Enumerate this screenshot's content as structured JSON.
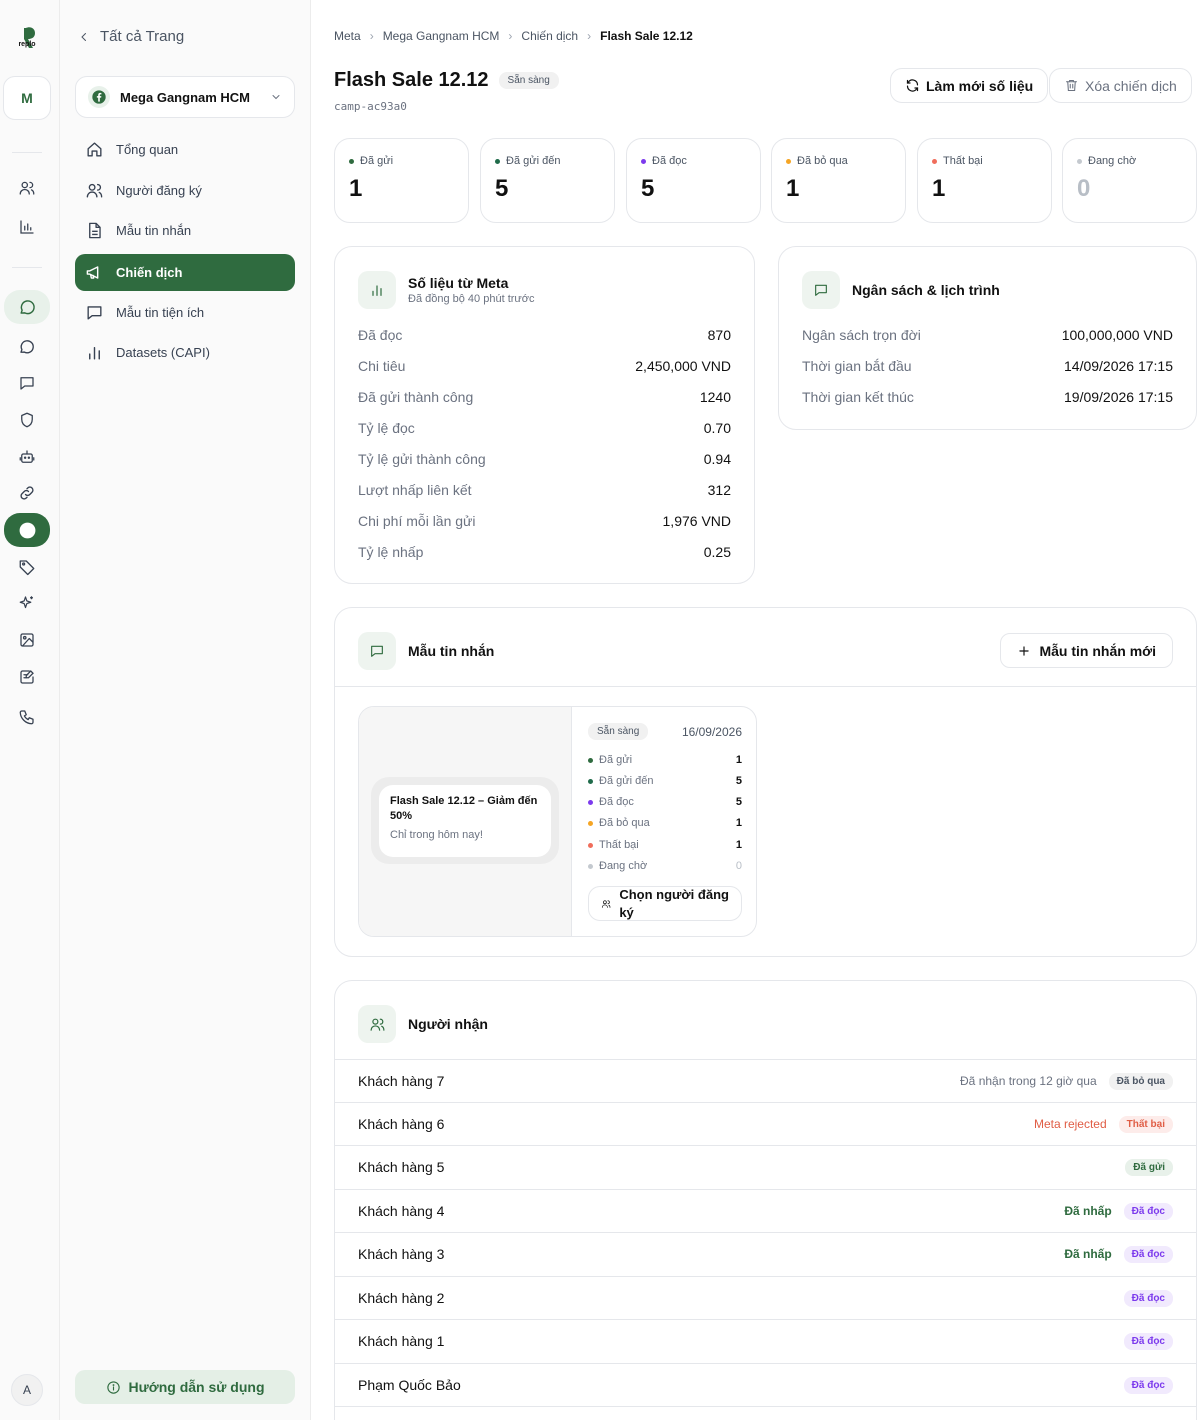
{
  "brand": {
    "logo_text": "replo",
    "workspace_initial": "M",
    "user_initial": "A"
  },
  "rail_icons": [
    "users-icon",
    "chart-icon",
    "chat-icon",
    "chat-outline-icon",
    "message-square-icon",
    "shield-icon",
    "bot-icon",
    "link-icon",
    "facebook-icon",
    "tag-icon",
    "sparkles-icon",
    "image-icon",
    "form-icon",
    "phone-icon"
  ],
  "sidebar": {
    "back_label": "Tất cả Trang",
    "page_name": "Mega Gangnam HCM",
    "items": [
      {
        "label": "Tổng quan",
        "icon": "home-icon"
      },
      {
        "label": "Người đăng ký",
        "icon": "users-icon"
      },
      {
        "label": "Mẫu tin nhắn",
        "icon": "file-text-icon"
      },
      {
        "label": "Chiến dịch",
        "icon": "megaphone-icon"
      },
      {
        "label": "Mẫu tin tiện ích",
        "icon": "message-square-icon"
      },
      {
        "label": "Datasets (CAPI)",
        "icon": "bar-chart-icon"
      }
    ],
    "guide_label": "Hướng dẫn sử dụng"
  },
  "breadcrumb": [
    "Meta",
    "Mega Gangnam HCM",
    "Chiến dịch",
    "Flash Sale 12.12"
  ],
  "campaign": {
    "title": "Flash Sale 12.12",
    "status": "Sẵn sàng",
    "code": "camp-ac93a0",
    "refresh_label": "Làm mới số liệu",
    "delete_label": "Xóa chiến dịch"
  },
  "colors": {
    "accent": "#2f6b3f",
    "sent": "#2f6b3f",
    "delivered": "#1f6b4a",
    "read": "#7c3aed",
    "skipped": "#f5a524",
    "failed": "#f06d5b",
    "pending": "#c4c9cf"
  },
  "stats": [
    {
      "label": "Đã gửi",
      "value": "1",
      "color": "#2f6b3f"
    },
    {
      "label": "Đã gửi đến",
      "value": "5",
      "color": "#1f6b4a"
    },
    {
      "label": "Đã đọc",
      "value": "5",
      "color": "#7c3aed"
    },
    {
      "label": "Đã bỏ qua",
      "value": "1",
      "color": "#f5a524"
    },
    {
      "label": "Thất bại",
      "value": "1",
      "color": "#f06d5b"
    },
    {
      "label": "Đang chờ",
      "value": "0",
      "color": "#c4c9cf"
    }
  ],
  "meta_metrics": {
    "title": "Số liệu từ Meta",
    "subtitle": "Đã đồng bộ 40 phút trước",
    "rows": [
      {
        "k": "Đã đọc",
        "v": "870"
      },
      {
        "k": "Chi tiêu",
        "v": "2,450,000 VND"
      },
      {
        "k": "Đã gửi thành công",
        "v": "1240"
      },
      {
        "k": "Tỷ lệ đọc",
        "v": "0.70"
      },
      {
        "k": "Tỷ lệ gửi thành công",
        "v": "0.94"
      },
      {
        "k": "Lượt nhấp liên kết",
        "v": "312"
      },
      {
        "k": "Chi phí mỗi lần gửi",
        "v": "1,976 VND"
      },
      {
        "k": "Tỷ lệ nhấp",
        "v": "0.25"
      }
    ]
  },
  "budget": {
    "title": "Ngân sách & lịch trình",
    "rows": [
      {
        "k": "Ngân sách trọn đời",
        "v": "100,000,000 VND"
      },
      {
        "k": "Thời gian bắt đầu",
        "v": "14/09/2026 17:15"
      },
      {
        "k": "Thời gian kết thúc",
        "v": "19/09/2026 17:15"
      }
    ]
  },
  "templates": {
    "title": "Mẫu tin nhắn",
    "new_label": "Mẫu tin nhắn mới",
    "card": {
      "preview_title": "Flash Sale 12.12 – Giảm đến 50%",
      "preview_body": "Chỉ trong hôm nay!",
      "status": "Sẵn sàng",
      "date": "16/09/2026",
      "rows": [
        {
          "label": "Đã gửi",
          "value": "1",
          "color": "#2f6b3f"
        },
        {
          "label": "Đã gửi đến",
          "value": "5",
          "color": "#1f6b4a"
        },
        {
          "label": "Đã đọc",
          "value": "5",
          "color": "#7c3aed"
        },
        {
          "label": "Đã bỏ qua",
          "value": "1",
          "color": "#f5a524"
        },
        {
          "label": "Thất bại",
          "value": "1",
          "color": "#f06d5b"
        },
        {
          "label": "Đang chờ",
          "value": "0",
          "color": "#c4c9cf"
        }
      ],
      "select_label": "Chọn người đăng ký"
    }
  },
  "recipients": {
    "title": "Người nhận",
    "rows": [
      {
        "name": "Khách hàng 7",
        "note": "Đã nhận trong 12 giờ qua",
        "note_style": "gray",
        "status": "Đã bỏ qua",
        "status_style": "skip"
      },
      {
        "name": "Khách hàng 6",
        "note": "Meta rejected",
        "note_style": "red",
        "status": "Thất bại",
        "status_style": "fail"
      },
      {
        "name": "Khách hàng 5",
        "note": "",
        "note_style": "gray",
        "status": "Đã gửi",
        "status_style": "sent"
      },
      {
        "name": "Khách hàng 4",
        "note": "Đã nhấp",
        "note_style": "green",
        "status": "Đã đọc",
        "status_style": "read"
      },
      {
        "name": "Khách hàng 3",
        "note": "Đã nhấp",
        "note_style": "green",
        "status": "Đã đọc",
        "status_style": "read"
      },
      {
        "name": "Khách hàng 2",
        "note": "",
        "note_style": "gray",
        "status": "Đã đọc",
        "status_style": "read"
      },
      {
        "name": "Khách hàng 1",
        "note": "",
        "note_style": "gray",
        "status": "Đã đọc",
        "status_style": "read"
      },
      {
        "name": "Phạm Quốc Bảo",
        "note": "",
        "note_style": "gray",
        "status": "Đã đọc",
        "status_style": "read"
      }
    ]
  }
}
